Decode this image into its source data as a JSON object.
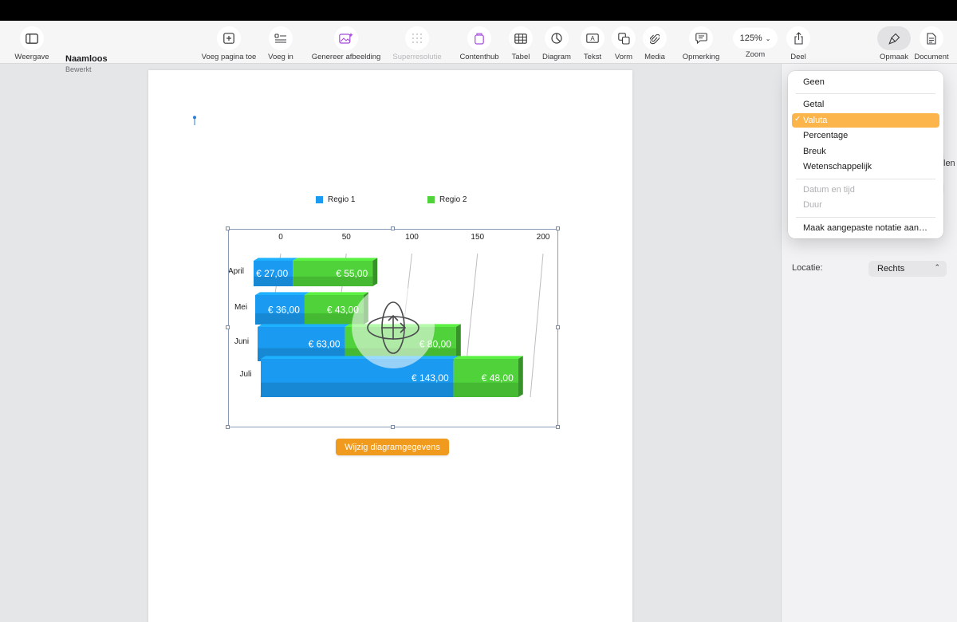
{
  "toolbar": {
    "view_label": "Weergave",
    "doc_title": "Naamloos",
    "doc_subtitle": "Bewerkt",
    "add_page_label": "Voeg pagina toe",
    "insert_label": "Voeg in",
    "generate_image_label": "Genereer afbeelding",
    "superres_label": "Superresolutie",
    "content_hub_label": "Contenthub",
    "table_label": "Tabel",
    "chart_label": "Diagram",
    "text_label": "Tekst",
    "shape_label": "Vorm",
    "media_label": "Media",
    "comment_label": "Opmerking",
    "zoom_value": "125%",
    "zoom_label": "Zoom",
    "share_label": "Deel",
    "format_label": "Opmaak",
    "document_label": "Document"
  },
  "format_menu": {
    "items": [
      {
        "label": "Geen",
        "state": "normal"
      },
      {
        "label": "Getal",
        "state": "normal"
      },
      {
        "label": "Valuta",
        "state": "selected"
      },
      {
        "label": "Percentage",
        "state": "normal"
      },
      {
        "label": "Breuk",
        "state": "normal"
      },
      {
        "label": "Wetenschappelijk",
        "state": "normal"
      },
      {
        "label": "Datum en tijd",
        "state": "disabled"
      },
      {
        "label": "Duur",
        "state": "disabled"
      },
      {
        "label": "Maak aangepaste notatie aan…",
        "state": "normal"
      }
    ],
    "checkmark": "✓"
  },
  "sidebar": {
    "partial_text": "len",
    "location_label": "Locatie:",
    "location_value": "Rechts"
  },
  "chart_data": {
    "type": "bar",
    "orientation": "horizontal",
    "stacked": true,
    "style": "3d",
    "categories": [
      "April",
      "Mei",
      "Juni",
      "Juli"
    ],
    "series": [
      {
        "name": "Regio 1",
        "values": [
          27,
          36,
          63,
          143
        ],
        "labels": [
          "€ 27,00",
          "€ 36,00",
          "€ 63,00",
          "€ 143,00"
        ],
        "color": "#1a9af0"
      },
      {
        "name": "Regio 2",
        "values": [
          55,
          43,
          80,
          48
        ],
        "labels": [
          "€ 55,00",
          "€ 43,00",
          "€ 80,00",
          "€ 48,00"
        ],
        "color": "#4fd23a"
      }
    ],
    "x_ticks": [
      "0",
      "50",
      "100",
      "150",
      "200"
    ],
    "xlim": [
      0,
      200
    ],
    "legend_position": "top",
    "grid": true
  },
  "edit_button_label": "Wijzig diagramgegevens",
  "colors": {
    "accent": "#f09a1e",
    "menu_highlight": "#fbb54a"
  }
}
